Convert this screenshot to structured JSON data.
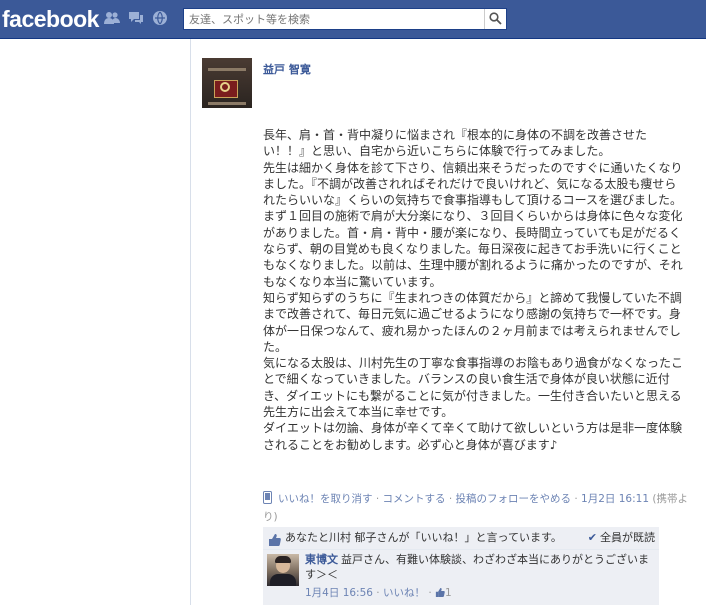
{
  "header": {
    "logo": "facebook",
    "search_placeholder": "友達、スポット等を検索",
    "brand_color": "#3b5998"
  },
  "post": {
    "author": "益戸 智寛",
    "paragraphs": [
      "長年、肩・首・背中凝りに悩まされ『根本的に身体の不調を改善させたい！！』と思い、自宅から近いこちらに体験で行ってみました。",
      "先生は細かく身体を診て下さり、信頼出来そうだったのですぐに通いたくなりました。『不調が改善されればそれだけで良いけれど、気になる太股も痩せられたらいいな』くらいの気持ちで食事指導もして頂けるコースを選びました。",
      "まず１回目の施術で肩が大分楽になり、３回目くらいからは身体に色々な変化がありました。首・肩・背中・腰が楽になり、長時間立っていても足がだるくならず、朝の目覚めも良くなりました。毎日深夜に起きてお手洗いに行くこともなくなりました。以前は、生理中腰が割れるように痛かったのですが、それもなくなり本当に驚いています。",
      "知らず知らずのうちに『生まれつきの体質だから』と諦めて我慢していた不調まで改善されて、毎日元気に過ごせるようになり感謝の気持ちで一杯です。身体が一日保つなんて、疲れ易かったほんの２ヶ月前までは考えられませんでした。",
      "気になる太股は、川村先生の丁寧な食事指導のお陰もあり過食がなくなったことで細くなっていきました。バランスの良い食生活で身体が良い状態に近付き、ダイエットにも繋がることに気が付きました。一生付き合いたいと思える先生方に出会えて本当に幸せです。",
      "ダイエットは勿論、身体が辛くて辛くて助けて欲しいという方は是非一度体験されることをお勧めします。必ず心と身体が喜びます♪"
    ],
    "actions": {
      "unlike": "いいね！を取り消す",
      "comment": "コメントする",
      "unfollow": "投稿のフォローをやめる",
      "timestamp": "1月2日 16:11",
      "via": "(携帯より)"
    }
  },
  "ufi": {
    "likes_text": "あなたと川村 郁子さんが「いいね！」と言っています。",
    "seen_text": "全員が既読",
    "comment": {
      "author": "東博文",
      "text": "益戸さん、有難い体験談、わざわざ本当にありがとうございます＞＜",
      "timestamp": "1月4日 16:56",
      "like_label": "いいね！",
      "like_count": "1"
    }
  }
}
